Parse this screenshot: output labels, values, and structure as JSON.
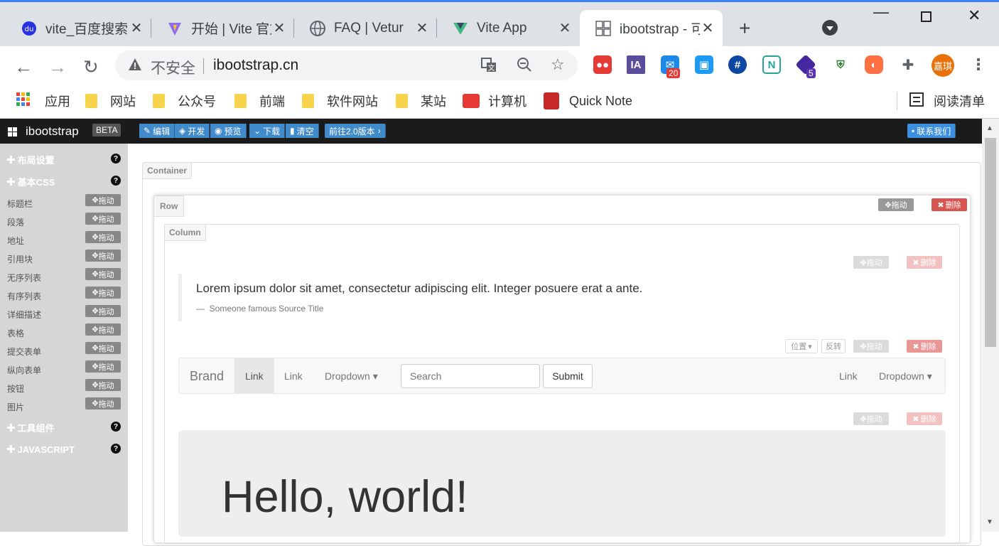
{
  "browser": {
    "tabs": [
      {
        "title": "vite_百度搜索",
        "icon": "baidu-icon"
      },
      {
        "title": "开始 | Vite 官方",
        "icon": "vite-icon"
      },
      {
        "title": "FAQ | Vetur",
        "icon": "globe-icon"
      },
      {
        "title": "Vite App",
        "icon": "vue-icon"
      },
      {
        "title": "ibootstrap - 可视化",
        "icon": "grid-icon",
        "active": true
      }
    ],
    "new_tab": "+",
    "security_label": "不安全",
    "url": "ibootstrap.cn",
    "ext_badges": {
      "mail": "20",
      "hex": "5"
    },
    "profile_label": "嘉琪",
    "bookmarks": [
      {
        "label": "应用",
        "icon": "apps-grid-icon"
      },
      {
        "label": "网站",
        "icon": "folder-icon"
      },
      {
        "label": "公众号",
        "icon": "folder-icon"
      },
      {
        "label": "前端",
        "icon": "folder-icon"
      },
      {
        "label": "软件网站",
        "icon": "folder-icon"
      },
      {
        "label": "某站",
        "icon": "folder-icon"
      },
      {
        "label": "计算机",
        "icon": "red-bookmark-icon"
      },
      {
        "label": "Quick Note",
        "icon": "notebook-icon"
      }
    ],
    "reading_list": "阅读清单"
  },
  "app": {
    "brand": "ibootstrap",
    "beta": "BETA",
    "toolbar": {
      "edit": "编辑",
      "develop": "开发",
      "preview": "预览",
      "download": "下载",
      "clear": "清空",
      "goto_v2": "前往2.0版本",
      "contact": "联系我们"
    },
    "sidebar": {
      "sections": {
        "layout": "布局设置",
        "css": "基本CSS",
        "tools": "工具组件",
        "js": "JAVASCRIPT"
      },
      "drag_label": "拖动",
      "items": [
        "标题栏",
        "段落",
        "地址",
        "引用块",
        "无序列表",
        "有序列表",
        "详细描述",
        "表格",
        "提交表单",
        "纵向表单",
        "按钮",
        "图片"
      ]
    },
    "canvas": {
      "container_label": "Container",
      "row_label": "Row",
      "column_label": "Column",
      "drag": "拖动",
      "delete": "删除",
      "position": "位置",
      "invert": "反转",
      "quote_text": "Lorem ipsum dolor sit amet, consectetur adipiscing elit. Integer posuere erat a ante.",
      "quote_source": "Someone famous Source Title",
      "navbar": {
        "brand": "Brand",
        "link1": "Link",
        "link2": "Link",
        "dropdown": "Dropdown",
        "search_placeholder": "Search",
        "submit": "Submit",
        "right_link": "Link",
        "right_dropdown": "Dropdown"
      },
      "jumbotron_heading": "Hello, world!"
    }
  }
}
